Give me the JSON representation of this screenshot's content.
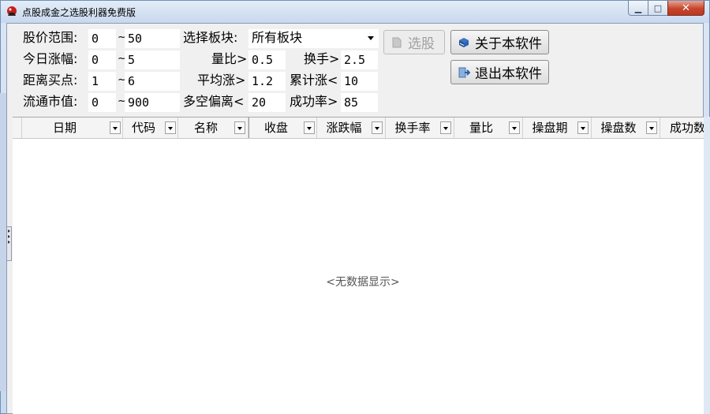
{
  "window": {
    "title": "点股成金之选股利器免费版",
    "min_glyph": "▁",
    "max_glyph": "□",
    "close_glyph": "✕"
  },
  "form": {
    "price_label": "股价范围:",
    "price_min": "0",
    "price_max": "50",
    "change_label": "今日涨幅:",
    "change_min": "0",
    "change_max": "5",
    "distance_label": "距离买点:",
    "distance_min": "1",
    "distance_max": "6",
    "cap_label": "流通市值:",
    "cap_min": "0",
    "cap_max": "900",
    "tilde": "~",
    "sector_label": "选择板块:",
    "sector_value": "所有板块",
    "vol_ratio_label": "量比>",
    "vol_ratio_value": "0.5",
    "turnover_label": "换手>",
    "turnover_value": "2.5",
    "avg_rise_label": "平均涨>",
    "avg_rise_value": "1.2",
    "cum_rise_label": "累计涨<",
    "cum_rise_value": "10",
    "bias_label": "多空偏离<",
    "bias_value": "20",
    "success_label": "成功率>",
    "success_value": "85"
  },
  "buttons": {
    "select_stock": "选股",
    "about": "关于本软件",
    "exit": "退出本软件"
  },
  "grid": {
    "columns": [
      "日期",
      "代码",
      "名称",
      "收盘",
      "涨跌幅",
      "换手率",
      "量比",
      "操盘期",
      "操盘数",
      "成功数"
    ],
    "empty_text": "<无数据显示>"
  },
  "colors": {
    "title_bg": "#d5e2f2",
    "client_bg": "#f0f0f0",
    "close_red": "#c7452c",
    "grid_bg": "#ffffff"
  }
}
